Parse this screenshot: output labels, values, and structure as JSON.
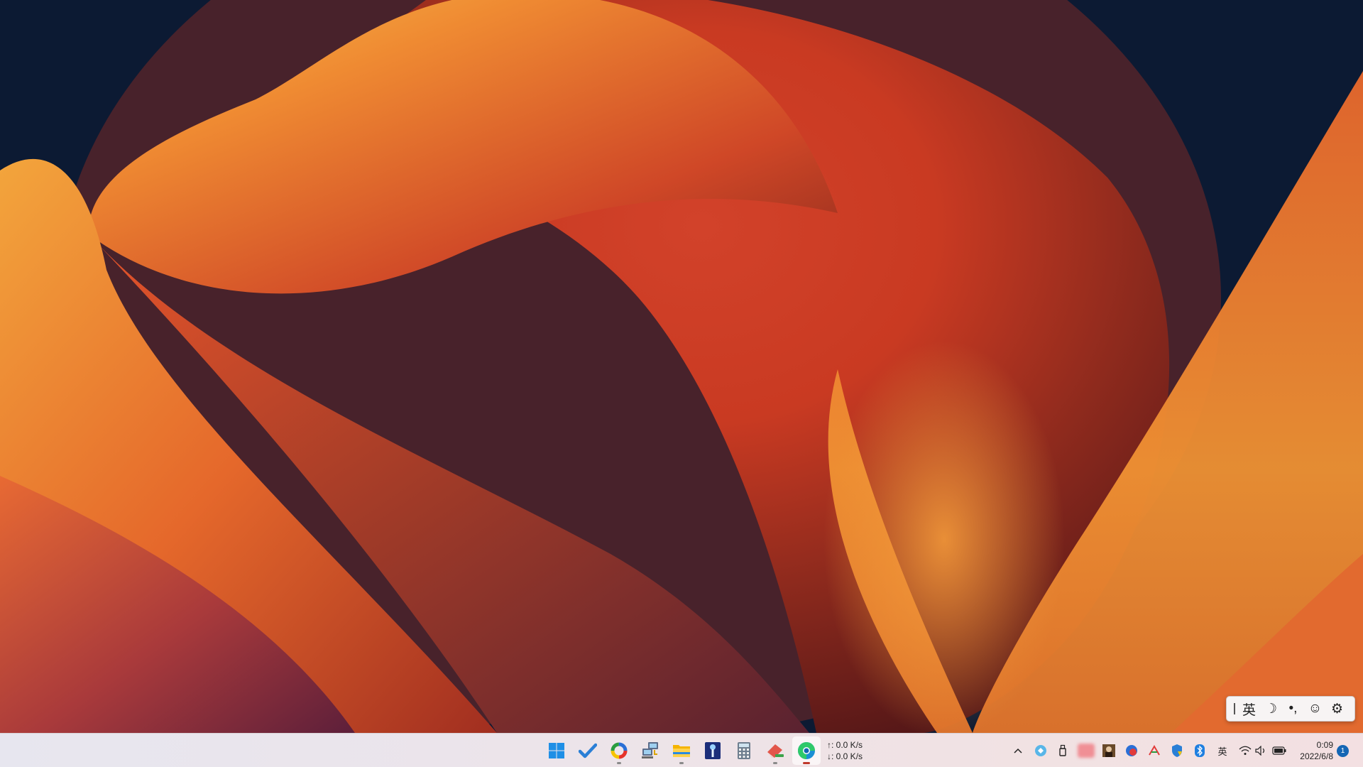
{
  "desktop": {
    "wallpaper": "macos-ventura-orange-abstract",
    "colors": {
      "sky": "#0c1a33",
      "orange": "#f08a2a",
      "red": "#b5321f",
      "yellow": "#f7b94a",
      "dark": "#4a1518"
    }
  },
  "ime_toolbar": {
    "items": [
      {
        "name": "ime-grip",
        "icon": "grip-icon",
        "label": ""
      },
      {
        "name": "ime-language",
        "icon": "language-icon",
        "label": "英"
      },
      {
        "name": "ime-halfwidth",
        "icon": "moon-icon",
        "label": "☽"
      },
      {
        "name": "ime-punctuation",
        "icon": "punctuation-icon",
        "label": "•,"
      },
      {
        "name": "ime-emoji",
        "icon": "emoji-icon",
        "label": "☺"
      },
      {
        "name": "ime-settings",
        "icon": "gear-icon",
        "label": "⚙"
      }
    ]
  },
  "taskbar": {
    "apps": [
      {
        "name": "start-button",
        "icon": "windows-logo-icon",
        "running": false,
        "active": false
      },
      {
        "name": "todo-app",
        "icon": "checkmark-icon",
        "running": false,
        "active": false
      },
      {
        "name": "color-app",
        "icon": "color-ring-icon",
        "running": true,
        "active": false
      },
      {
        "name": "network-app",
        "icon": "network-computers-icon",
        "running": false,
        "active": false
      },
      {
        "name": "file-explorer",
        "icon": "folder-icon",
        "running": true,
        "active": false
      },
      {
        "name": "tool-app",
        "icon": "blue-tool-icon",
        "running": false,
        "active": false
      },
      {
        "name": "calculator",
        "icon": "calculator-icon",
        "running": false,
        "active": false
      },
      {
        "name": "eraser-app",
        "icon": "eraser-icon",
        "running": true,
        "active": false
      },
      {
        "name": "edge-browser",
        "icon": "edge-icon",
        "running": true,
        "active": true
      }
    ],
    "netspeed": {
      "up": "↑: 0.0 K/s",
      "down": "↓: 0.0 K/s"
    },
    "tray": {
      "overflow": "^",
      "ime_label": "英",
      "icons": [
        "overflow-chevron-icon",
        "blue-app-icon",
        "usb-icon",
        "blurred-icon",
        "avatar-icon",
        "red-app-icon",
        "pen-icon",
        "security-shield-icon",
        "bluetooth-icon",
        "ime-icon",
        "wifi-icon",
        "volume-icon",
        "battery-icon"
      ]
    },
    "clock": {
      "time": "0:09",
      "date": "2022/6/8"
    },
    "notifications": {
      "count": "1"
    }
  }
}
